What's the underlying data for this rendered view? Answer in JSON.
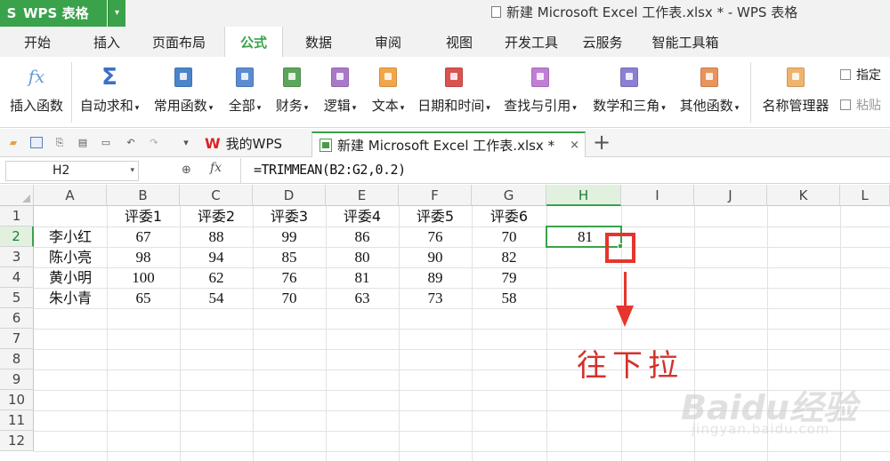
{
  "title_bar": {
    "app_name": "WPS 表格",
    "app_menu_arrow": "▾",
    "window_title": "新建 Microsoft Excel 工作表.xlsx * - WPS 表格"
  },
  "ribbon_tabs": [
    "开始",
    "插入",
    "页面布局",
    "公式",
    "数据",
    "审阅",
    "视图",
    "开发工具",
    "云服务",
    "智能工具箱"
  ],
  "active_tab": "公式",
  "ribbon": {
    "insert_function": "插入函数",
    "autosum": "自动求和",
    "common": "常用函数",
    "all": "全部",
    "finance": "财务",
    "logic": "逻辑",
    "text": "文本",
    "datetime": "日期和时间",
    "lookup": "查找与引用",
    "math": "数学和三角",
    "other": "其他函数",
    "name_manager": "名称管理器",
    "specify": "指定",
    "paste": "粘贴",
    "icon_fx": "fx",
    "icon_sum": "Σ"
  },
  "doc_tabs": {
    "home": "我的WPS",
    "file": "新建 Microsoft Excel 工作表.xlsx *",
    "wps_w": "W",
    "close": "×",
    "new": "+"
  },
  "formula_bar": {
    "name_box": "H2",
    "fx": "fx",
    "formula": "=TRIMMEAN(B2:G2,0.2)"
  },
  "sheet": {
    "columns": [
      "A",
      "B",
      "C",
      "D",
      "E",
      "F",
      "G",
      "H",
      "I",
      "J",
      "K",
      "L"
    ],
    "rows": [
      "1",
      "2",
      "3",
      "4",
      "5",
      "6",
      "7",
      "8",
      "9",
      "10",
      "11",
      "12"
    ],
    "headers": [
      "评委1",
      "评委2",
      "评委3",
      "评委4",
      "评委5",
      "评委6"
    ],
    "data": [
      {
        "name": "李小红",
        "scores": [
          "67",
          "88",
          "99",
          "86",
          "76",
          "70"
        ],
        "result": "81"
      },
      {
        "name": "陈小亮",
        "scores": [
          "98",
          "94",
          "85",
          "80",
          "90",
          "82"
        ],
        "result": ""
      },
      {
        "name": "黄小明",
        "scores": [
          "100",
          "62",
          "76",
          "81",
          "89",
          "79"
        ],
        "result": ""
      },
      {
        "name": "朱小青",
        "scores": [
          "65",
          "54",
          "70",
          "63",
          "73",
          "58"
        ],
        "result": ""
      }
    ],
    "selected_cell": "H2"
  },
  "annotation": "往下拉",
  "watermark": {
    "brand": "Baidu经验",
    "url": "jingyan.baidu.com"
  },
  "colors": {
    "accent": "#3aa24a",
    "annotation": "#e5352c"
  }
}
